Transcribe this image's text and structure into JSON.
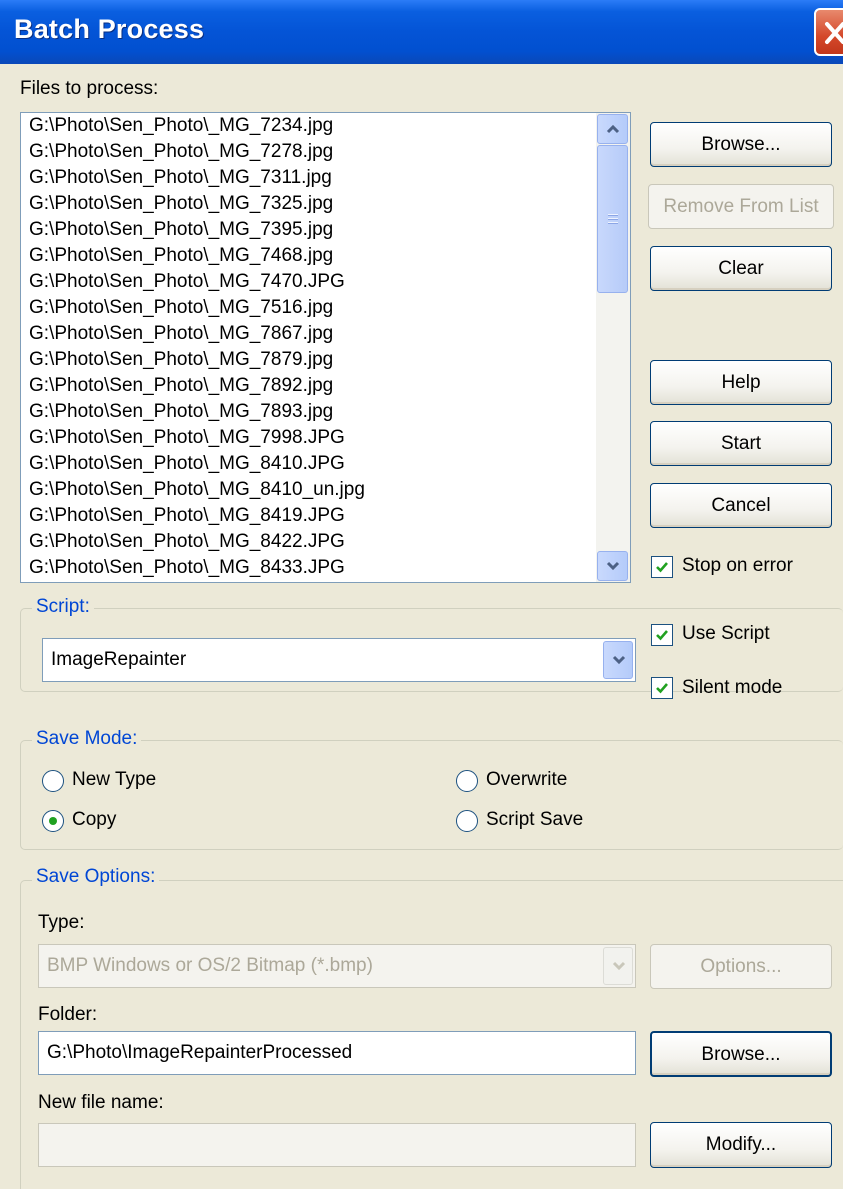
{
  "window": {
    "title": "Batch Process"
  },
  "files": {
    "label": "Files to process:",
    "items": [
      "G:\\Photo\\Sen_Photo\\_MG_7234.jpg",
      "G:\\Photo\\Sen_Photo\\_MG_7278.jpg",
      "G:\\Photo\\Sen_Photo\\_MG_7311.jpg",
      "G:\\Photo\\Sen_Photo\\_MG_7325.jpg",
      "G:\\Photo\\Sen_Photo\\_MG_7395.jpg",
      "G:\\Photo\\Sen_Photo\\_MG_7468.jpg",
      "G:\\Photo\\Sen_Photo\\_MG_7470.JPG",
      "G:\\Photo\\Sen_Photo\\_MG_7516.jpg",
      "G:\\Photo\\Sen_Photo\\_MG_7867.jpg",
      "G:\\Photo\\Sen_Photo\\_MG_7879.jpg",
      "G:\\Photo\\Sen_Photo\\_MG_7892.jpg",
      "G:\\Photo\\Sen_Photo\\_MG_7893.jpg",
      "G:\\Photo\\Sen_Photo\\_MG_7998.JPG",
      "G:\\Photo\\Sen_Photo\\_MG_8410.JPG",
      "G:\\Photo\\Sen_Photo\\_MG_8410_un.jpg",
      "G:\\Photo\\Sen_Photo\\_MG_8419.JPG",
      "G:\\Photo\\Sen_Photo\\_MG_8422.JPG",
      "G:\\Photo\\Sen_Photo\\_MG_8433.JPG"
    ]
  },
  "side_buttons": {
    "browse": "Browse...",
    "remove": "Remove From List",
    "clear": "Clear",
    "help": "Help",
    "start": "Start",
    "cancel": "Cancel"
  },
  "stop_on_error": {
    "label": "Stop on error",
    "checked": true
  },
  "script": {
    "group_title": "Script:",
    "selected": "ImageRepainter",
    "use_script": {
      "label": "Use Script",
      "checked": true
    },
    "silent_mode": {
      "label": "Silent mode",
      "checked": true
    }
  },
  "save_mode": {
    "group_title": "Save Mode:",
    "options": {
      "new_type": "New Type",
      "copy": "Copy",
      "overwrite": "Overwrite",
      "script_save": "Script Save"
    },
    "selected": "Copy"
  },
  "save_options": {
    "group_title": "Save Options:",
    "type_label": "Type:",
    "type_value": "BMP Windows or OS/2 Bitmap (*.bmp)",
    "options_button": "Options...",
    "folder_label": "Folder:",
    "folder_value": "G:\\Photo\\ImageRepainterProcessed",
    "browse_button": "Browse...",
    "new_file_name_label": "New file name:",
    "new_file_name_value": "",
    "modify_button": "Modify..."
  },
  "colors": {
    "titlebar": "#0454D6",
    "dialog_bg": "#ECE9D8",
    "group_title": "#0046D5",
    "check": "#21A121"
  },
  "icons": [
    "close-icon",
    "scroll-up-icon",
    "scroll-down-icon",
    "dropdown-arrow-icon",
    "checkmark-icon"
  ]
}
